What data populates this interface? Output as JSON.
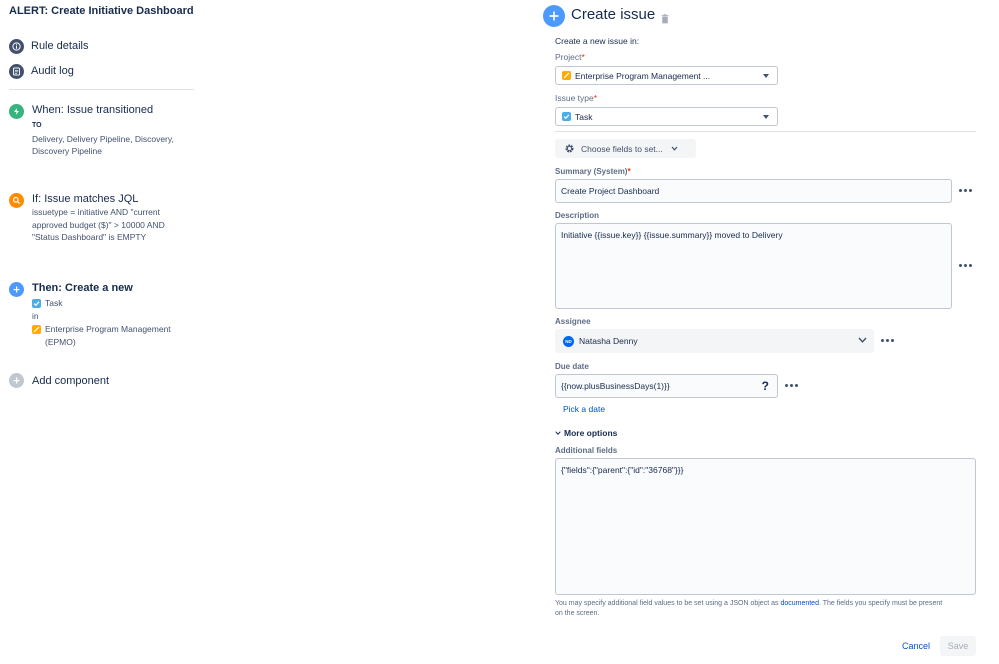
{
  "left": {
    "rule_title": "ALERT: Create Initiative Dashboard",
    "nav": [
      {
        "label": "Rule details",
        "icon": "info-icon"
      },
      {
        "label": "Audit log",
        "icon": "log-icon"
      }
    ],
    "trigger": {
      "heading": "When: Issue transitioned",
      "to_label": "TO",
      "statuses": "Delivery, Delivery Pipeline, Discovery,",
      "statuses2": "Discovery Pipeline"
    },
    "condition": {
      "heading": "If: Issue matches JQL",
      "line1": "issuetype = initiative AND \"current",
      "line2": "approved budget ($)\" > 10000 AND",
      "line3": "\"Status Dashboard\" is EMPTY"
    },
    "action": {
      "heading": "Then: Create a new",
      "issue_type": "Task",
      "in_label": "in",
      "project_line1": "Enterprise Program Management",
      "project_line2": "(EPMO)"
    },
    "add_component": "Add component"
  },
  "right": {
    "title": "Create issue",
    "create_in_label": "Create a new issue in:",
    "project_label": "Project",
    "project_value": "Enterprise Program Management ...",
    "issue_type_label": "Issue type",
    "issue_type_value": "Task",
    "choose_fields": "Choose fields to set...",
    "summary_label": "Summary (System)",
    "summary_value": "Create Project Dashboard",
    "description_label": "Description",
    "description_value": "Initiative {{issue.key}} {{issue.summary}} moved to Delivery",
    "assignee_label": "Assignee",
    "assignee_initials": "ND",
    "assignee_value": "Natasha Denny",
    "due_date_label": "Due date",
    "due_date_value": "{{now.plusBusinessDays(1)}}",
    "help_glyph": "?",
    "pick_date": "Pick a date",
    "more_options": "More options",
    "additional_label": "Additional fields",
    "additional_value": "{\"fields\":{\"parent\":{\"id\":\"36768\"}}}",
    "help_text_1": "You may specify additional field values to be set using a JSON object as ",
    "help_link": "documented",
    "help_text_2": ". The fields you specify must be present",
    "help_text_3": "on the screen.",
    "cancel": "Cancel",
    "save": "Save"
  },
  "colors": {
    "trigger": "#36b37e",
    "condition": "#ff8b00",
    "action": "#4c9aff",
    "add": "#c1c7d0",
    "epmo_icon": "#ffab00",
    "task_icon": "#4bade8",
    "avatar": "#0065ff",
    "link": "#0052cc"
  }
}
